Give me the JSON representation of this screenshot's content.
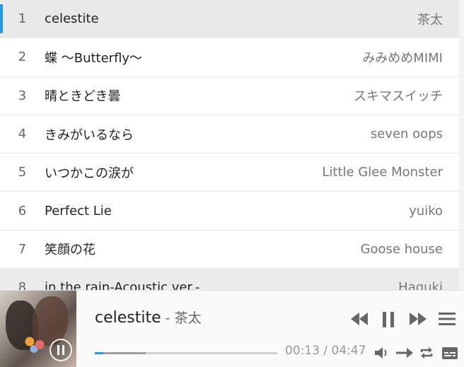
{
  "playlist": [
    {
      "num": "1",
      "title": "celestite",
      "artist": "茶太",
      "state": "active"
    },
    {
      "num": "2",
      "title": "蝶 〜Butterfly〜",
      "artist": "みみめめMIMI",
      "state": ""
    },
    {
      "num": "3",
      "title": "晴ときどき曇",
      "artist": "スキマスイッチ",
      "state": ""
    },
    {
      "num": "4",
      "title": "きみがいるなら",
      "artist": "seven oops",
      "state": ""
    },
    {
      "num": "5",
      "title": "いつかこの涙が",
      "artist": "Little Glee Monster",
      "state": ""
    },
    {
      "num": "6",
      "title": "Perfect Lie",
      "artist": "yuiko",
      "state": ""
    },
    {
      "num": "7",
      "title": "笑顔の花",
      "artist": "Goose house",
      "state": ""
    },
    {
      "num": "8",
      "title": "in the rain-Acoustic ver.-",
      "artist": "Haguki",
      "state": "hover"
    }
  ],
  "player": {
    "title": "celestite",
    "separator": " - ",
    "artist": "茶太",
    "current_time": "00:13",
    "time_separator": " / ",
    "duration": "04:47",
    "played_fraction": 0.045,
    "loaded_fraction": 0.28,
    "accent_color": "#2f97dc"
  },
  "icons": {
    "cover_overlay": "pause-icon",
    "prev": "skip-back-icon",
    "play_pause": "pause-icon",
    "next": "skip-forward-icon",
    "menu": "menu-icon",
    "volume": "volume-icon",
    "order": "order-arrow-icon",
    "loop": "loop-icon",
    "lyrics": "lyrics-icon"
  }
}
